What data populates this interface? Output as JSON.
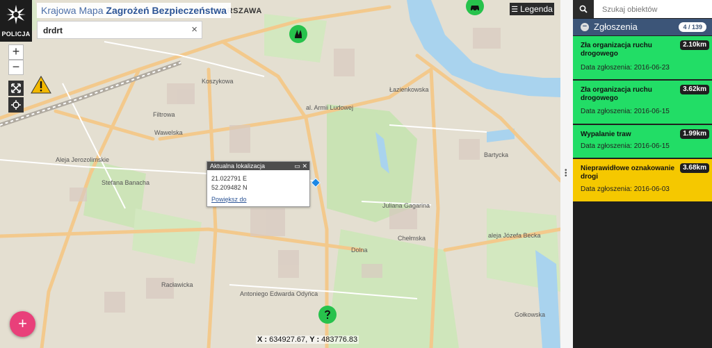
{
  "header": {
    "logo_label": "POLICJA",
    "title_light": "Krajowa Mapa",
    "title_bold": "Zagrożeń Bezpieczeństwa"
  },
  "search": {
    "value": "drdrt",
    "clear_icon": "×"
  },
  "controls": {
    "zoom_in": "+",
    "zoom_out": "−",
    "fullscreen_icon": "fullscreen-icon",
    "locate_icon": "crosshair-icon"
  },
  "legend": {
    "label": "Legenda"
  },
  "map_labels": {
    "city": "WARSZAWA",
    "streets": [
      "Koszykowa",
      "Filtrowa",
      "Wawelska",
      "al. Armii Ludowej",
      "Łazienkowska",
      "Stefana Banacha",
      "Aleja Jerozolimskie",
      "Racławicka",
      "Antoniego Edwarda Odyńca",
      "Juliana Gagarina",
      "Chełmska",
      "aleja Józefa Becka",
      "Bartycka",
      "Gołkowska",
      "Dolna"
    ]
  },
  "popup": {
    "title": "Aktualna lokalizacja",
    "lon": "21.022791 E",
    "lat": "52.209482 N",
    "link": "Powiększ do"
  },
  "coordinates": {
    "x_label": "X :",
    "x_value": "634927.67,",
    "y_label": "Y :",
    "y_value": "483776.83"
  },
  "fab_label": "+",
  "panel": {
    "search_placeholder": "Szukaj obiektów",
    "section_title": "Zgłoszenia",
    "count": "4 / 139",
    "items": [
      {
        "name": "Zła organizacja ruchu drogowego",
        "distance": "2.10km",
        "date_label": "Data zgłoszenia:",
        "date": "2016-06-23",
        "color": "#22dd66"
      },
      {
        "name": "Zła organizacja ruchu drogowego",
        "distance": "3.62km",
        "date_label": "Data zgłoszenia:",
        "date": "2016-06-15",
        "color": "#22dd66"
      },
      {
        "name": "Wypalanie traw",
        "distance": "1.99km",
        "date_label": "Data zgłoszenia:",
        "date": "2016-06-15",
        "color": "#22dd66"
      },
      {
        "name": "Nieprawidłowe oznakowanie drogi",
        "distance": "3.68km",
        "date_label": "Data zgłoszenia:",
        "date": "2016-06-03",
        "color": "#f5c800"
      }
    ]
  },
  "colors": {
    "panel_header": "#3c5578",
    "marker_green": "#27c24c",
    "fab": "#e9407a",
    "warning": "#f2b800"
  }
}
